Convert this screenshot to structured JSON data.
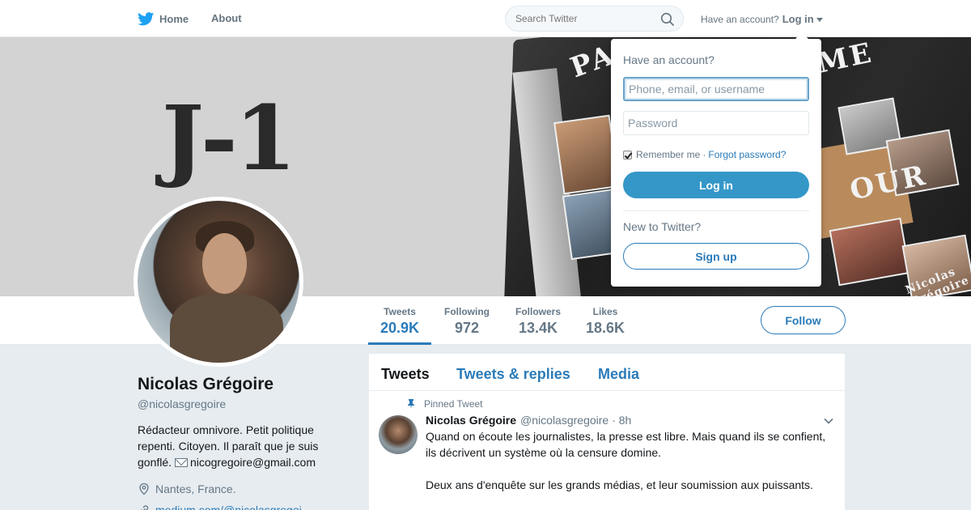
{
  "nav": {
    "home": "Home",
    "about": "About",
    "search_placeholder": "Search Twitter",
    "have_account": "Have an account?",
    "login": "Log in"
  },
  "banner": {
    "text": "J-1",
    "book_words": [
      "PA",
      "ME",
      "OUR",
      "Nicolas Grégoire"
    ]
  },
  "profile": {
    "name": "Nicolas Grégoire",
    "handle": "@nicolasgregoire",
    "bio": "Rédacteur omnivore. Petit politique repenti. Citoyen. Il paraît que je suis gonflé.",
    "email": "nicogregoire@gmail.com",
    "location": "Nantes, France.",
    "url": "medium.com/@nicolasgregoi..."
  },
  "stats": [
    {
      "label": "Tweets",
      "value": "20.9K",
      "active": true
    },
    {
      "label": "Following",
      "value": "972"
    },
    {
      "label": "Followers",
      "value": "13.4K"
    },
    {
      "label": "Likes",
      "value": "18.6K"
    }
  ],
  "follow": "Follow",
  "tabs": [
    "Tweets",
    "Tweets & replies",
    "Media"
  ],
  "tweet": {
    "pinned_label": "Pinned Tweet",
    "name": "Nicolas Grégoire",
    "handle": "@nicolasgregoire",
    "time": "· 8h",
    "line1": "Quand on écoute les journalistes, la presse est libre. Mais quand ils se confient, ils décrivent un système où la censure domine.",
    "line2": "Deux ans d'enquête sur les grands médias, et leur soumission aux puissants."
  },
  "login_dropdown": {
    "title": "Have an account?",
    "user_placeholder": "Phone, email, or username",
    "password_placeholder": "Password",
    "remember": "Remember me",
    "forgot": "Forgot password?",
    "login_button": "Log in",
    "new_to_twitter": "New to Twitter?",
    "signup_button": "Sign up"
  },
  "colors": {
    "accent": "#2b7bb9",
    "login_button": "#3497c8",
    "background": "#e6ecf0"
  },
  "icons": [
    "twitter-bird-icon",
    "search-icon",
    "caret-down-icon",
    "location-pin-icon",
    "link-icon",
    "pin-icon",
    "chevron-down-icon",
    "envelope-icon",
    "checkbox-icon"
  ]
}
